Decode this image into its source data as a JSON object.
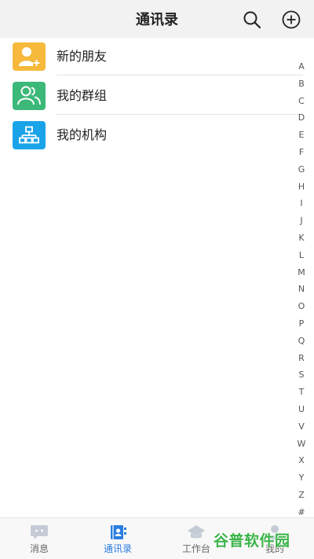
{
  "header": {
    "title": "通讯录",
    "search_icon": "search-icon",
    "add_icon": "plus-circle-icon"
  },
  "entries": [
    {
      "label": "新的朋友",
      "icon": "add-user-icon",
      "color": "#f6b93b"
    },
    {
      "label": "我的群组",
      "icon": "group-icon",
      "color": "#3cb878"
    },
    {
      "label": "我的机构",
      "icon": "org-chart-icon",
      "color": "#1aa3e8"
    }
  ],
  "index_letters": [
    "A",
    "B",
    "C",
    "D",
    "E",
    "F",
    "G",
    "H",
    "I",
    "J",
    "K",
    "L",
    "M",
    "N",
    "O",
    "P",
    "Q",
    "R",
    "S",
    "T",
    "U",
    "V",
    "W",
    "X",
    "Y",
    "Z",
    "#"
  ],
  "tabs": [
    {
      "label": "消息",
      "icon": "message-icon",
      "active": false
    },
    {
      "label": "通讯录",
      "icon": "contacts-icon",
      "active": true
    },
    {
      "label": "工作台",
      "icon": "workbench-icon",
      "active": false
    },
    {
      "label": "我的",
      "icon": "profile-icon",
      "active": false
    }
  ],
  "watermark": {
    "text": "谷普软件园"
  },
  "colors": {
    "accent": "#2a7de1",
    "watermark": "#3cb44a"
  }
}
